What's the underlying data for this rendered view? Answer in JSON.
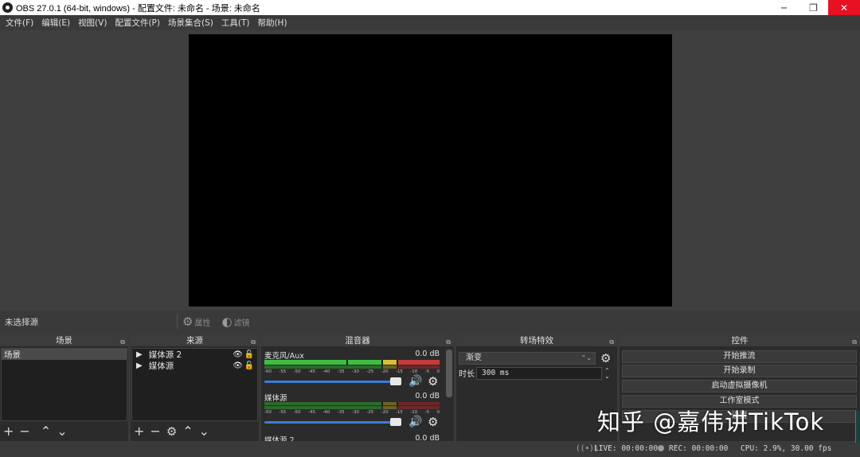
{
  "window": {
    "title": "OBS 27.0.1 (64-bit, windows) - 配置文件: 未命名 - 场景: 未命名",
    "minimize": "─",
    "restore": "❐",
    "close": "✕"
  },
  "menu": [
    "文件(F)",
    "编辑(E)",
    "视图(V)",
    "配置文件(P)",
    "场景集合(S)",
    "工具(T)",
    "帮助(H)"
  ],
  "source_toolbar": {
    "no_source": "未选择源",
    "properties": "属性",
    "filters": "滤镜"
  },
  "scenes": {
    "title": "场景",
    "items": [
      "场景"
    ]
  },
  "sources": {
    "title": "来源",
    "items": [
      "媒体源 2",
      "媒体源"
    ]
  },
  "mixer": {
    "title": "混音器",
    "channels": [
      {
        "name": "麦克风/Aux",
        "level": "0.0 dB"
      },
      {
        "name": "媒体源",
        "level": "0.0 dB"
      },
      {
        "name": "媒体源 2",
        "level": "0.0 dB"
      }
    ],
    "scale": [
      "-60",
      "-55",
      "-50",
      "-45",
      "-40",
      "-35",
      "-30",
      "-25",
      "-20",
      "-15",
      "-10",
      "-5",
      "0"
    ]
  },
  "transitions": {
    "title": "转场特效",
    "selected": "渐变",
    "duration_label": "时长",
    "duration_value": "300 ms"
  },
  "controls": {
    "title": "控件",
    "buttons": [
      "开始推流",
      "开始录制",
      "启动虚拟摄像机",
      "工作室模式",
      "设置"
    ]
  },
  "status": {
    "live": "LIVE: 00:00:00",
    "rec": "REC: 00:00:00",
    "cpu": "CPU: 2.9%, 30.00 fps"
  },
  "watermark": "知乎 @嘉伟讲TikTok",
  "colors": {
    "accent_fader": "#3b7ed8",
    "meter_green": "#3fbf3f",
    "meter_yellow": "#d6c23a",
    "meter_red": "#c83a3a"
  }
}
